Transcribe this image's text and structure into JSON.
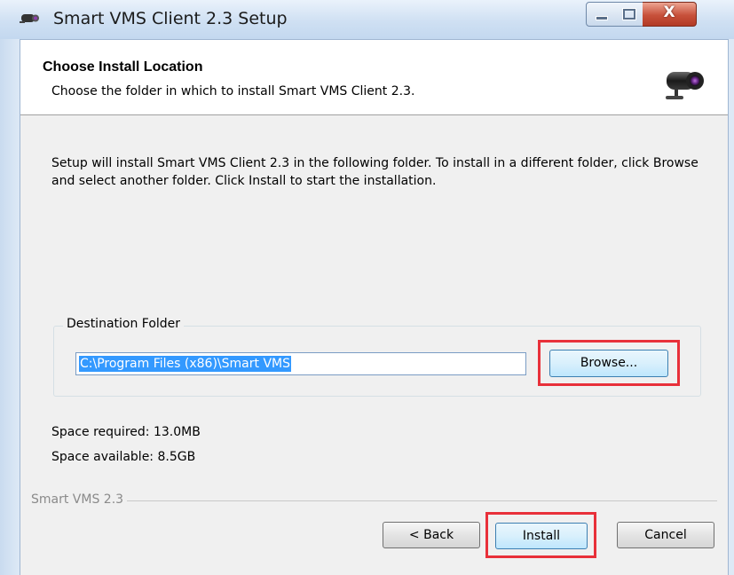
{
  "window": {
    "title": "Smart VMS Client 2.3 Setup",
    "close_glyph": "X",
    "icons": {
      "app": "camera-icon",
      "minimize": "minimize-icon",
      "maximize": "maximize-icon",
      "close": "close-icon"
    }
  },
  "header": {
    "title": "Choose Install Location",
    "subtitle": "Choose the folder in which to install Smart VMS Client 2.3.",
    "icon": "security-camera-icon"
  },
  "body": {
    "description": "Setup will install Smart VMS Client 2.3 in the following folder. To install in a different folder, click Browse and select another folder. Click Install to start the installation.",
    "destination_group_label": "Destination Folder",
    "destination_path": "C:\\Program Files (x86)\\Smart VMS",
    "browse_label": "Browse...",
    "space_required": "Space required: 13.0MB",
    "space_available": "Space available: 8.5GB"
  },
  "footer": {
    "brand": "Smart VMS 2.3",
    "back_label": "< Back",
    "install_label": "Install",
    "cancel_label": "Cancel"
  },
  "colors": {
    "highlight_box": "#e8303a",
    "selection": "#3399ff",
    "dialog_background": "#f0f0f0"
  }
}
